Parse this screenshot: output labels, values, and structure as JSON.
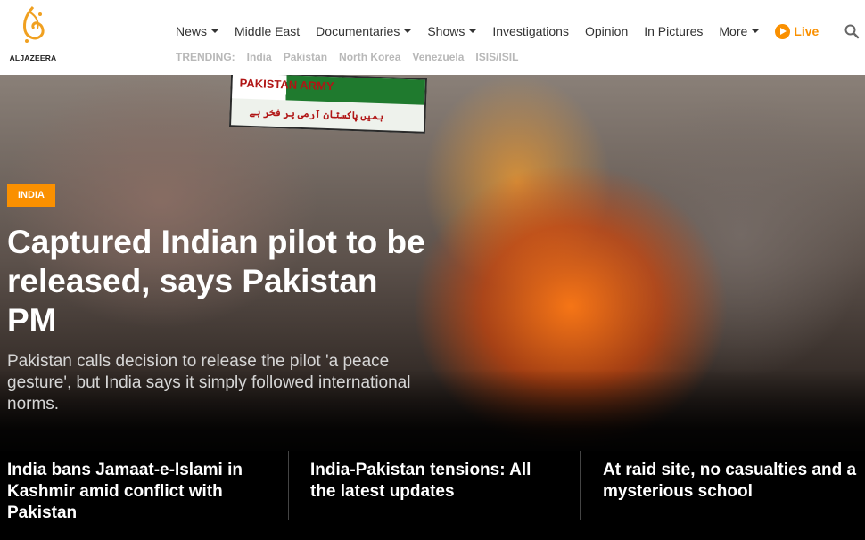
{
  "brand": {
    "logo_text": "ALJAZEERA",
    "accent": "#fa9000"
  },
  "nav": {
    "items": [
      {
        "label": "News",
        "dropdown": true
      },
      {
        "label": "Middle East",
        "dropdown": false
      },
      {
        "label": "Documentaries",
        "dropdown": true
      },
      {
        "label": "Shows",
        "dropdown": true
      },
      {
        "label": "Investigations",
        "dropdown": false
      },
      {
        "label": "Opinion",
        "dropdown": false
      },
      {
        "label": "In Pictures",
        "dropdown": false
      },
      {
        "label": "More",
        "dropdown": true
      }
    ],
    "live_label": "Live",
    "search_icon": "search-icon"
  },
  "trending": {
    "label": "TRENDING:",
    "items": [
      "India",
      "Pakistan",
      "North Korea",
      "Venezuela",
      "ISIS/ISIL"
    ]
  },
  "hero": {
    "banner_text": "PAKISTAN ARMY",
    "banner_sub": "ہمیں پاکستان آرمی پر فخر ہے",
    "tag": "INDIA",
    "headline": "Captured Indian pilot to be released, says Pakistan PM",
    "summary": "Pakistan calls decision to release the pilot 'a peace gesture', but India says it simply followed international norms."
  },
  "stories": [
    {
      "title": "India bans Jamaat-e-Islami in Kashmir amid conflict with Pakistan"
    },
    {
      "title": "India-Pakistan tensions: All the latest updates"
    },
    {
      "title": "At raid site, no casualties and a mysterious school"
    }
  ]
}
